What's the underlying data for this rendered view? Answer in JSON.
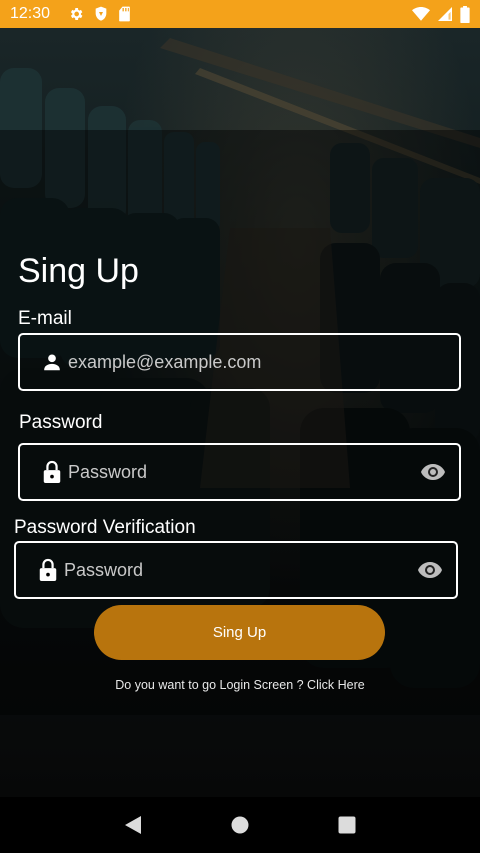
{
  "status_bar": {
    "time": "12:30"
  },
  "form": {
    "title": "Sing Up",
    "email_label": "E-mail",
    "email_placeholder": "example@example.com",
    "password_label": "Password",
    "password_placeholder": "Password",
    "verify_label": "Password Verification",
    "verify_placeholder": "Password",
    "submit_label": "Sing Up",
    "login_prompt": "Do you want to go Login Screen ? Click Here"
  },
  "colors": {
    "status_bar": "#F4A21A",
    "button": "#B8740D"
  },
  "icons": [
    "settings-icon",
    "shield-icon",
    "sd-card-icon",
    "wifi-icon",
    "signal-icon",
    "battery-icon",
    "person-icon",
    "lock-icon",
    "eye-icon",
    "back-icon",
    "home-icon",
    "recents-icon"
  ]
}
